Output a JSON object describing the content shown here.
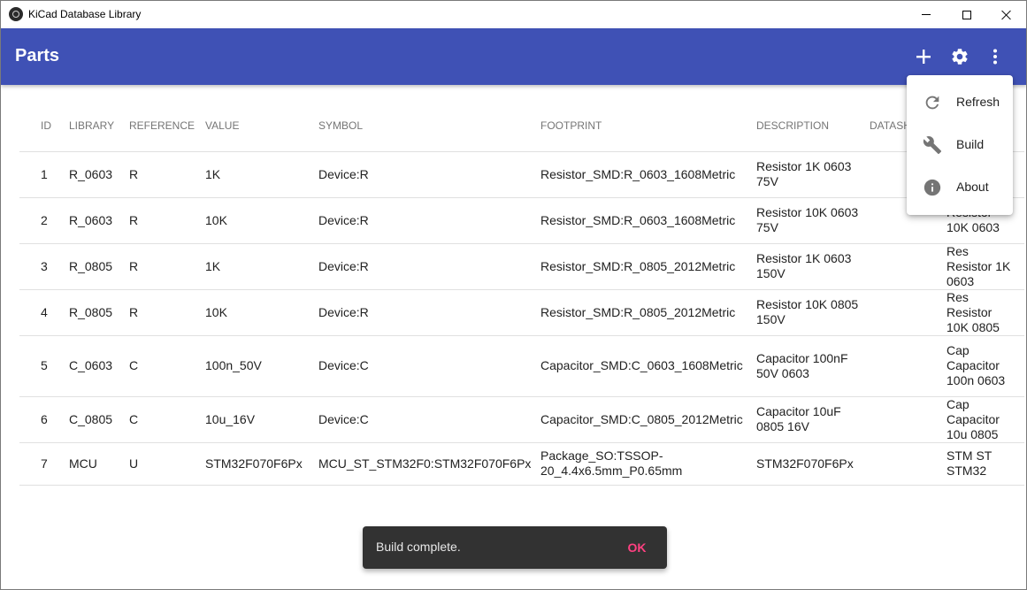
{
  "window": {
    "title": "KiCad Database Library"
  },
  "appbar": {
    "title": "Parts",
    "icons": [
      "add-icon",
      "settings-icon",
      "more-vert-icon"
    ]
  },
  "table": {
    "headers": [
      "ID",
      "LIBRARY",
      "REFERENCE",
      "VALUE",
      "SYMBOL",
      "FOOTPRINT",
      "DESCRIPTION",
      "DATASH"
    ],
    "rows": [
      {
        "id": "1",
        "library": "R_0603",
        "reference": "R",
        "value": "1K",
        "symbol": "Device:R",
        "footprint": "Resistor_SMD:R_0603_1608Metric",
        "description": "Resistor 1K 0603 75V",
        "extra": ""
      },
      {
        "id": "2",
        "library": "R_0603",
        "reference": "R",
        "value": "10K",
        "symbol": "Device:R",
        "footprint": "Resistor_SMD:R_0603_1608Metric",
        "description": "Resistor 10K 0603 75V",
        "extra": "Resistor 10K 0603"
      },
      {
        "id": "3",
        "library": "R_0805",
        "reference": "R",
        "value": "1K",
        "symbol": "Device:R",
        "footprint": "Resistor_SMD:R_0805_2012Metric",
        "description": "Resistor 1K 0603 150V",
        "extra": "Res Resistor 1K 0603"
      },
      {
        "id": "4",
        "library": "R_0805",
        "reference": "R",
        "value": "10K",
        "symbol": "Device:R",
        "footprint": "Resistor_SMD:R_0805_2012Metric",
        "description": "Resistor 10K 0805 150V",
        "extra": "Res Resistor 10K 0805"
      },
      {
        "id": "5",
        "library": "C_0603",
        "reference": "C",
        "value": "100n_50V",
        "symbol": "Device:C",
        "footprint": "Capacitor_SMD:C_0603_1608Metric",
        "description": "Capacitor 100nF 50V 0603",
        "extra": "Cap Capacitor 100n 0603"
      },
      {
        "id": "6",
        "library": "C_0805",
        "reference": "C",
        "value": "10u_16V",
        "symbol": "Device:C",
        "footprint": "Capacitor_SMD:C_0805_2012Metric",
        "description": "Capacitor 10uF 0805 16V",
        "extra": "Cap Capacitor 10u 0805"
      },
      {
        "id": "7",
        "library": "MCU",
        "reference": "U",
        "value": "STM32F070F6Px",
        "symbol": "MCU_ST_STM32F0:STM32F070F6Px",
        "footprint": "Package_SO:TSSOP-20_4.4x6.5mm_P0.65mm",
        "description": "STM32F070F6Px",
        "extra": "STM ST STM32"
      }
    ]
  },
  "menu": {
    "items": [
      {
        "label": "Refresh",
        "icon": "refresh-icon"
      },
      {
        "label": "Build",
        "icon": "wrench-icon"
      },
      {
        "label": "About",
        "icon": "info-icon"
      }
    ]
  },
  "snackbar": {
    "message": "Build complete.",
    "action": "OK"
  },
  "colors": {
    "primary": "#3f51b5",
    "snackbar_bg": "#323232",
    "accent": "#ff4081"
  }
}
